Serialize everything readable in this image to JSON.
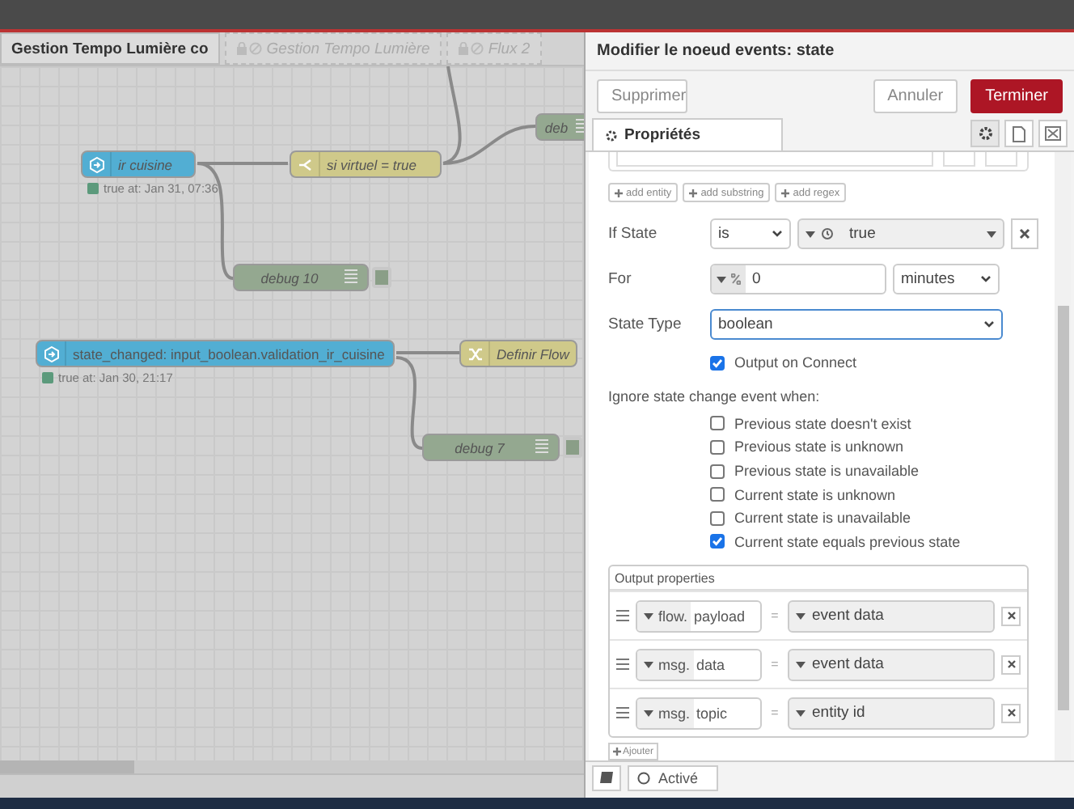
{
  "workspace_tabs": [
    {
      "label": "Gestion Tempo Lumière co",
      "selected": true,
      "disabled": false
    },
    {
      "label": "Gestion Tempo Lumière",
      "selected": false,
      "disabled": true
    },
    {
      "label": "Flux 2",
      "selected": false,
      "disabled": true
    }
  ],
  "nodes": [
    {
      "kind": "inject",
      "label": "ir cuisine",
      "status": "true at: Jan 31, 07:36"
    },
    {
      "kind": "switch",
      "label": "si virtuel = true"
    },
    {
      "kind": "debug",
      "label": "debug 10"
    },
    {
      "kind": "debug",
      "label": "deb"
    },
    {
      "kind": "inject",
      "label": "state_changed: input_boolean.validation_ir_cuisine",
      "status": "true at: Jan 30, 21:17"
    },
    {
      "kind": "change",
      "label": "Definir Flow"
    },
    {
      "kind": "debug",
      "label": "debug 7"
    }
  ],
  "dialog": {
    "title": "Modifier le noeud events: state",
    "delete_button": "Supprimer",
    "cancel_button": "Annuler",
    "done_button": "Terminer",
    "tab": "Propriétés",
    "add_buttons": [
      "add entity",
      "add substring",
      "add regex"
    ],
    "if_state": {
      "label": "If State",
      "operator": "is",
      "value": "true"
    },
    "for": {
      "label": "For",
      "value": "0",
      "unit": "minutes"
    },
    "state_type": {
      "label": "State Type",
      "value": "boolean"
    },
    "output_on_connect": {
      "label": "Output on Connect",
      "checked": true
    },
    "ignore_heading": "Ignore state change event when:",
    "ignore_options": [
      {
        "label": "Previous state doesn't exist",
        "checked": false
      },
      {
        "label": "Previous state is unknown",
        "checked": false
      },
      {
        "label": "Previous state is unavailable",
        "checked": false
      },
      {
        "label": "Current state is unknown",
        "checked": false
      },
      {
        "label": "Current state is unavailable",
        "checked": false
      },
      {
        "label": "Current state equals previous state",
        "checked": true
      }
    ],
    "output_properties": {
      "heading": "Output properties",
      "rows": [
        {
          "target_type": "flow.",
          "property": "payload",
          "equals": "=",
          "value": "event data"
        },
        {
          "target_type": "msg.",
          "property": "data",
          "equals": "=",
          "value": "event data"
        },
        {
          "target_type": "msg.",
          "property": "topic",
          "equals": "=",
          "value": "entity id"
        }
      ],
      "add_button": "Ajouter"
    },
    "status": {
      "label": "Activé"
    }
  }
}
